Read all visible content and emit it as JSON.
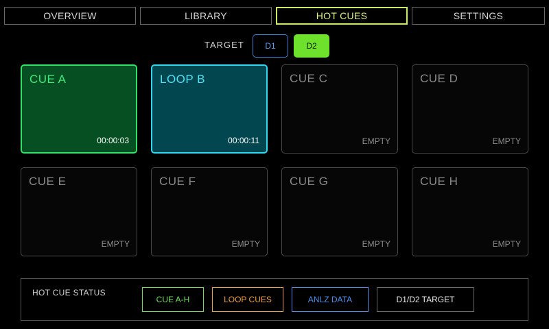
{
  "tabs": [
    {
      "label": "OVERVIEW"
    },
    {
      "label": "LIBRARY"
    },
    {
      "label": "HOT CUES",
      "active": true
    },
    {
      "label": "SETTINGS"
    }
  ],
  "target": {
    "label": "TARGET",
    "decks": [
      {
        "label": "D1",
        "selected": false
      },
      {
        "label": "D2",
        "selected": true
      }
    ]
  },
  "pads": [
    {
      "name": "CUE A",
      "status": "00:00:03",
      "state": "cue"
    },
    {
      "name": "LOOP B",
      "status": "00:00:11",
      "state": "loop"
    },
    {
      "name": "CUE C",
      "status": "EMPTY",
      "state": "empty"
    },
    {
      "name": "CUE D",
      "status": "EMPTY",
      "state": "empty"
    },
    {
      "name": "CUE E",
      "status": "EMPTY",
      "state": "empty"
    },
    {
      "name": "CUE F",
      "status": "EMPTY",
      "state": "empty"
    },
    {
      "name": "CUE G",
      "status": "EMPTY",
      "state": "empty"
    },
    {
      "name": "CUE H",
      "status": "EMPTY",
      "state": "empty"
    }
  ],
  "status_panel": {
    "title": "HOT CUE STATUS",
    "chips": [
      {
        "label": "CUE A-H",
        "color": "#6fdc5a"
      },
      {
        "label": "LOOP CUES",
        "color": "#f0a042"
      },
      {
        "label": "ANLZ DATA",
        "color": "#4a90e8"
      },
      {
        "label": "D1/D2 TARGET",
        "color": "#e8e8e8"
      }
    ]
  },
  "colors": {
    "accent_tab": "#c9ec6a",
    "deck_d2": "#6de12b",
    "deck_d1": "#3f7fd0",
    "cue_active": "#2fe06a",
    "loop_active": "#2fd8f0"
  }
}
